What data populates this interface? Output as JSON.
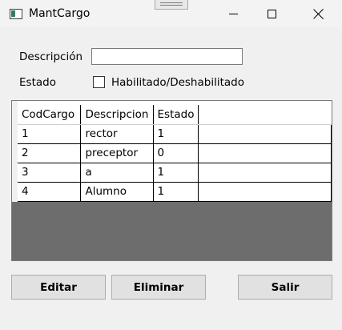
{
  "window": {
    "title": "MantCargo"
  },
  "form": {
    "descripcion_label": "Descripción",
    "descripcion_value": "",
    "estado_label": "Estado",
    "estado_checkbox_label": "Habilitado/Deshabilitado",
    "estado_checked": false
  },
  "grid": {
    "columns": [
      "CodCargo",
      "Descripcion",
      "Estado"
    ],
    "rows": [
      [
        "1",
        "rector",
        "1"
      ],
      [
        "2",
        "preceptor",
        "0"
      ],
      [
        "3",
        "a",
        "1"
      ],
      [
        "4",
        "Alumno",
        "1"
      ]
    ]
  },
  "buttons": {
    "editar": "Editar",
    "eliminar": "Eliminar",
    "salir": "Salir"
  },
  "icons": {
    "app": "app-window-icon",
    "minimize": "minimize-icon",
    "maximize": "maximize-icon",
    "close": "close-icon",
    "grip": "drag-grip-icon"
  }
}
